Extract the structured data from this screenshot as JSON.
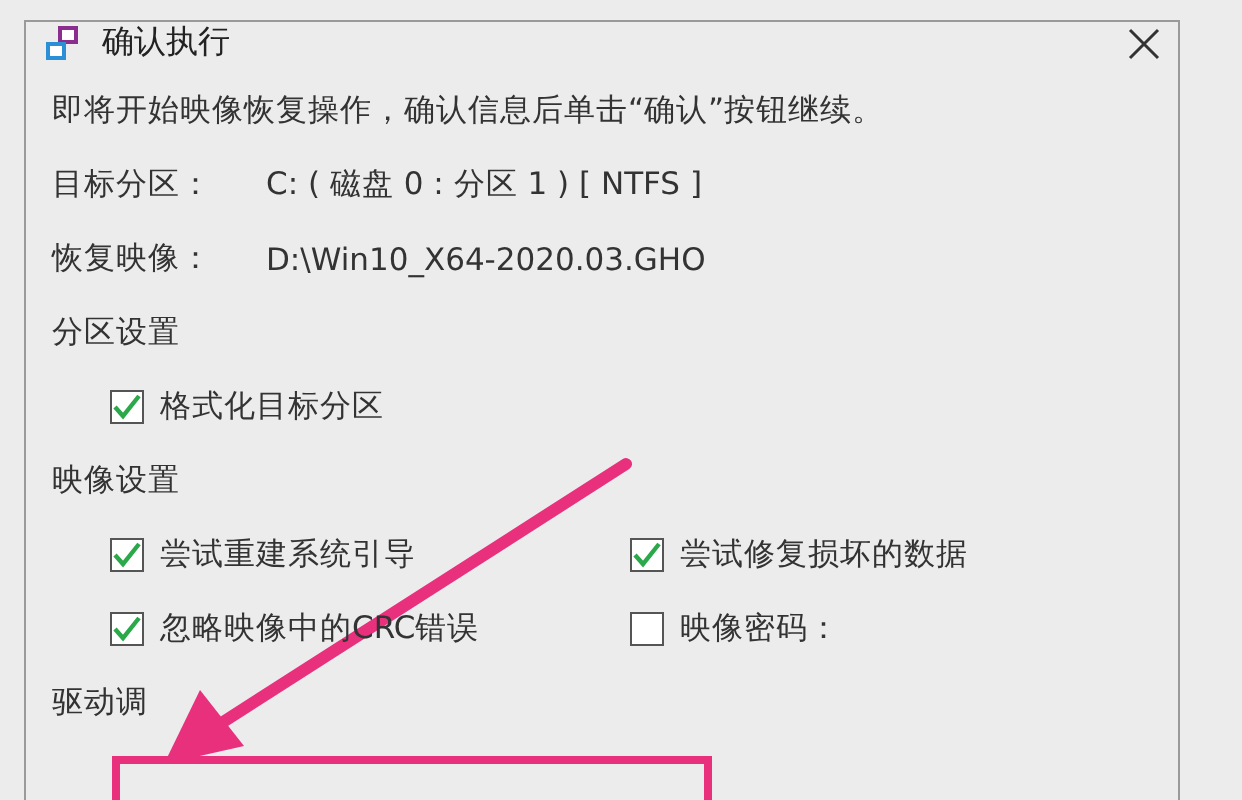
{
  "window": {
    "title": "确认执行"
  },
  "intro": "即将开始映像恢复操作，确认信息后单击“确认”按钮继续。",
  "info": [
    {
      "label": "目标分区：",
      "value": "C:  ( 磁盘 0 : 分区 1 ) [ NTFS ]"
    },
    {
      "label": "恢复映像：",
      "value": "D:\\Win10_X64-2020.03.GHO"
    }
  ],
  "partition_settings": {
    "heading": "分区设置",
    "options": [
      {
        "label": "格式化目标分区",
        "checked": true
      }
    ]
  },
  "image_settings": {
    "heading": "映像设置",
    "options": [
      {
        "label": "尝试重建系统引导",
        "checked": true
      },
      {
        "label": "尝试修复损坏的数据",
        "checked": true
      },
      {
        "label": "忽略映像中的CRC错误",
        "checked": true
      },
      {
        "label": "映像密码：",
        "checked": false
      }
    ]
  },
  "driver_settings": {
    "heading": "驱动调"
  }
}
